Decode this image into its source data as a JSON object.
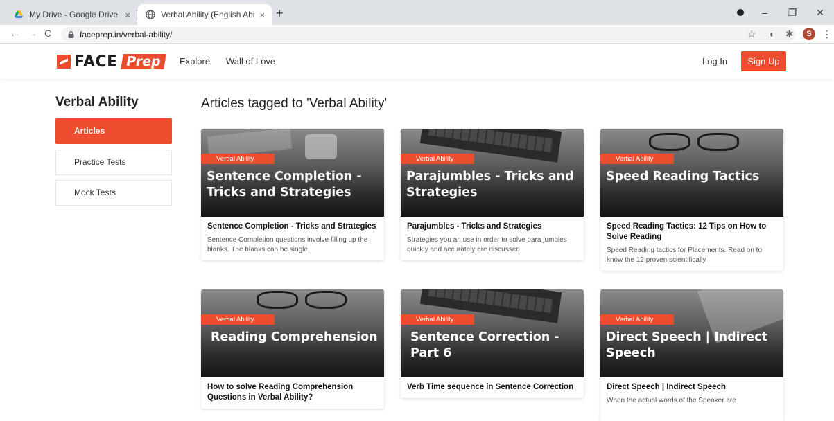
{
  "browser": {
    "tabs": [
      {
        "title": "My Drive - Google Drive",
        "close": "×"
      },
      {
        "title": "Verbal Ability (English Ability) Te",
        "close": "×"
      }
    ],
    "new_tab": "+",
    "window_controls": {
      "minimize": "–",
      "restore": "❐",
      "close": "✕"
    },
    "nav": {
      "back": "←",
      "forward": "→",
      "reload": "C"
    },
    "url": "faceprep.in/verbal-ability/",
    "toolbar_icons": {
      "star": "☆",
      "extensions": "✱",
      "menu": "⋮"
    },
    "profile_initial": "S"
  },
  "header": {
    "logo_face": "FACE",
    "logo_prep": "Prep",
    "nav": [
      "Explore",
      "Wall of Love"
    ],
    "login": "Log In",
    "signup": "Sign Up"
  },
  "sidebar": {
    "title": "Verbal Ability",
    "items": [
      {
        "label": "Articles",
        "active": true
      },
      {
        "label": "Practice Tests",
        "active": false
      },
      {
        "label": "Mock Tests",
        "active": false
      }
    ]
  },
  "main": {
    "title": "Articles tagged to 'Verbal Ability'",
    "cards": [
      {
        "tag": "Verbal Ability",
        "image_title": "Sentence Completion - Tricks and Strategies",
        "title": "Sentence Completion - Tricks and Strategies",
        "desc": "Sentence Completion questions involve filling up the blanks. The blanks can be single,"
      },
      {
        "tag": "Verbal Ability",
        "image_title": "Parajumbles - Tricks and Strategies",
        "title": "Parajumbles - Tricks and Strategies",
        "desc": "Strategies you an use in order to solve para jumbles quickly and accurately are discussed"
      },
      {
        "tag": "Verbal Ability",
        "image_title": "Speed Reading Tactics",
        "title": "Speed Reading Tactics: 12 Tips on How to Solve Reading",
        "desc": "Speed Reading tactics for Placements. Read on to know the 12 proven scientifically"
      },
      {
        "tag": "Verbal Ability",
        "image_title": "Reading Comprehension",
        "title": "How to solve Reading Comprehension Questions in Verbal Ability?",
        "desc": ""
      },
      {
        "tag": "Verbal Ability",
        "image_title": "Sentence Correction - Part 6",
        "title": "Verb Time sequence in Sentence Correction",
        "desc": ""
      },
      {
        "tag": "Verbal Ability",
        "image_title": "Direct Speech | Indirect Speech",
        "title": "Direct Speech | Indirect Speech",
        "desc": "When the actual words of the Speaker are"
      }
    ]
  },
  "colors": {
    "accent": "#ed4d2e"
  }
}
